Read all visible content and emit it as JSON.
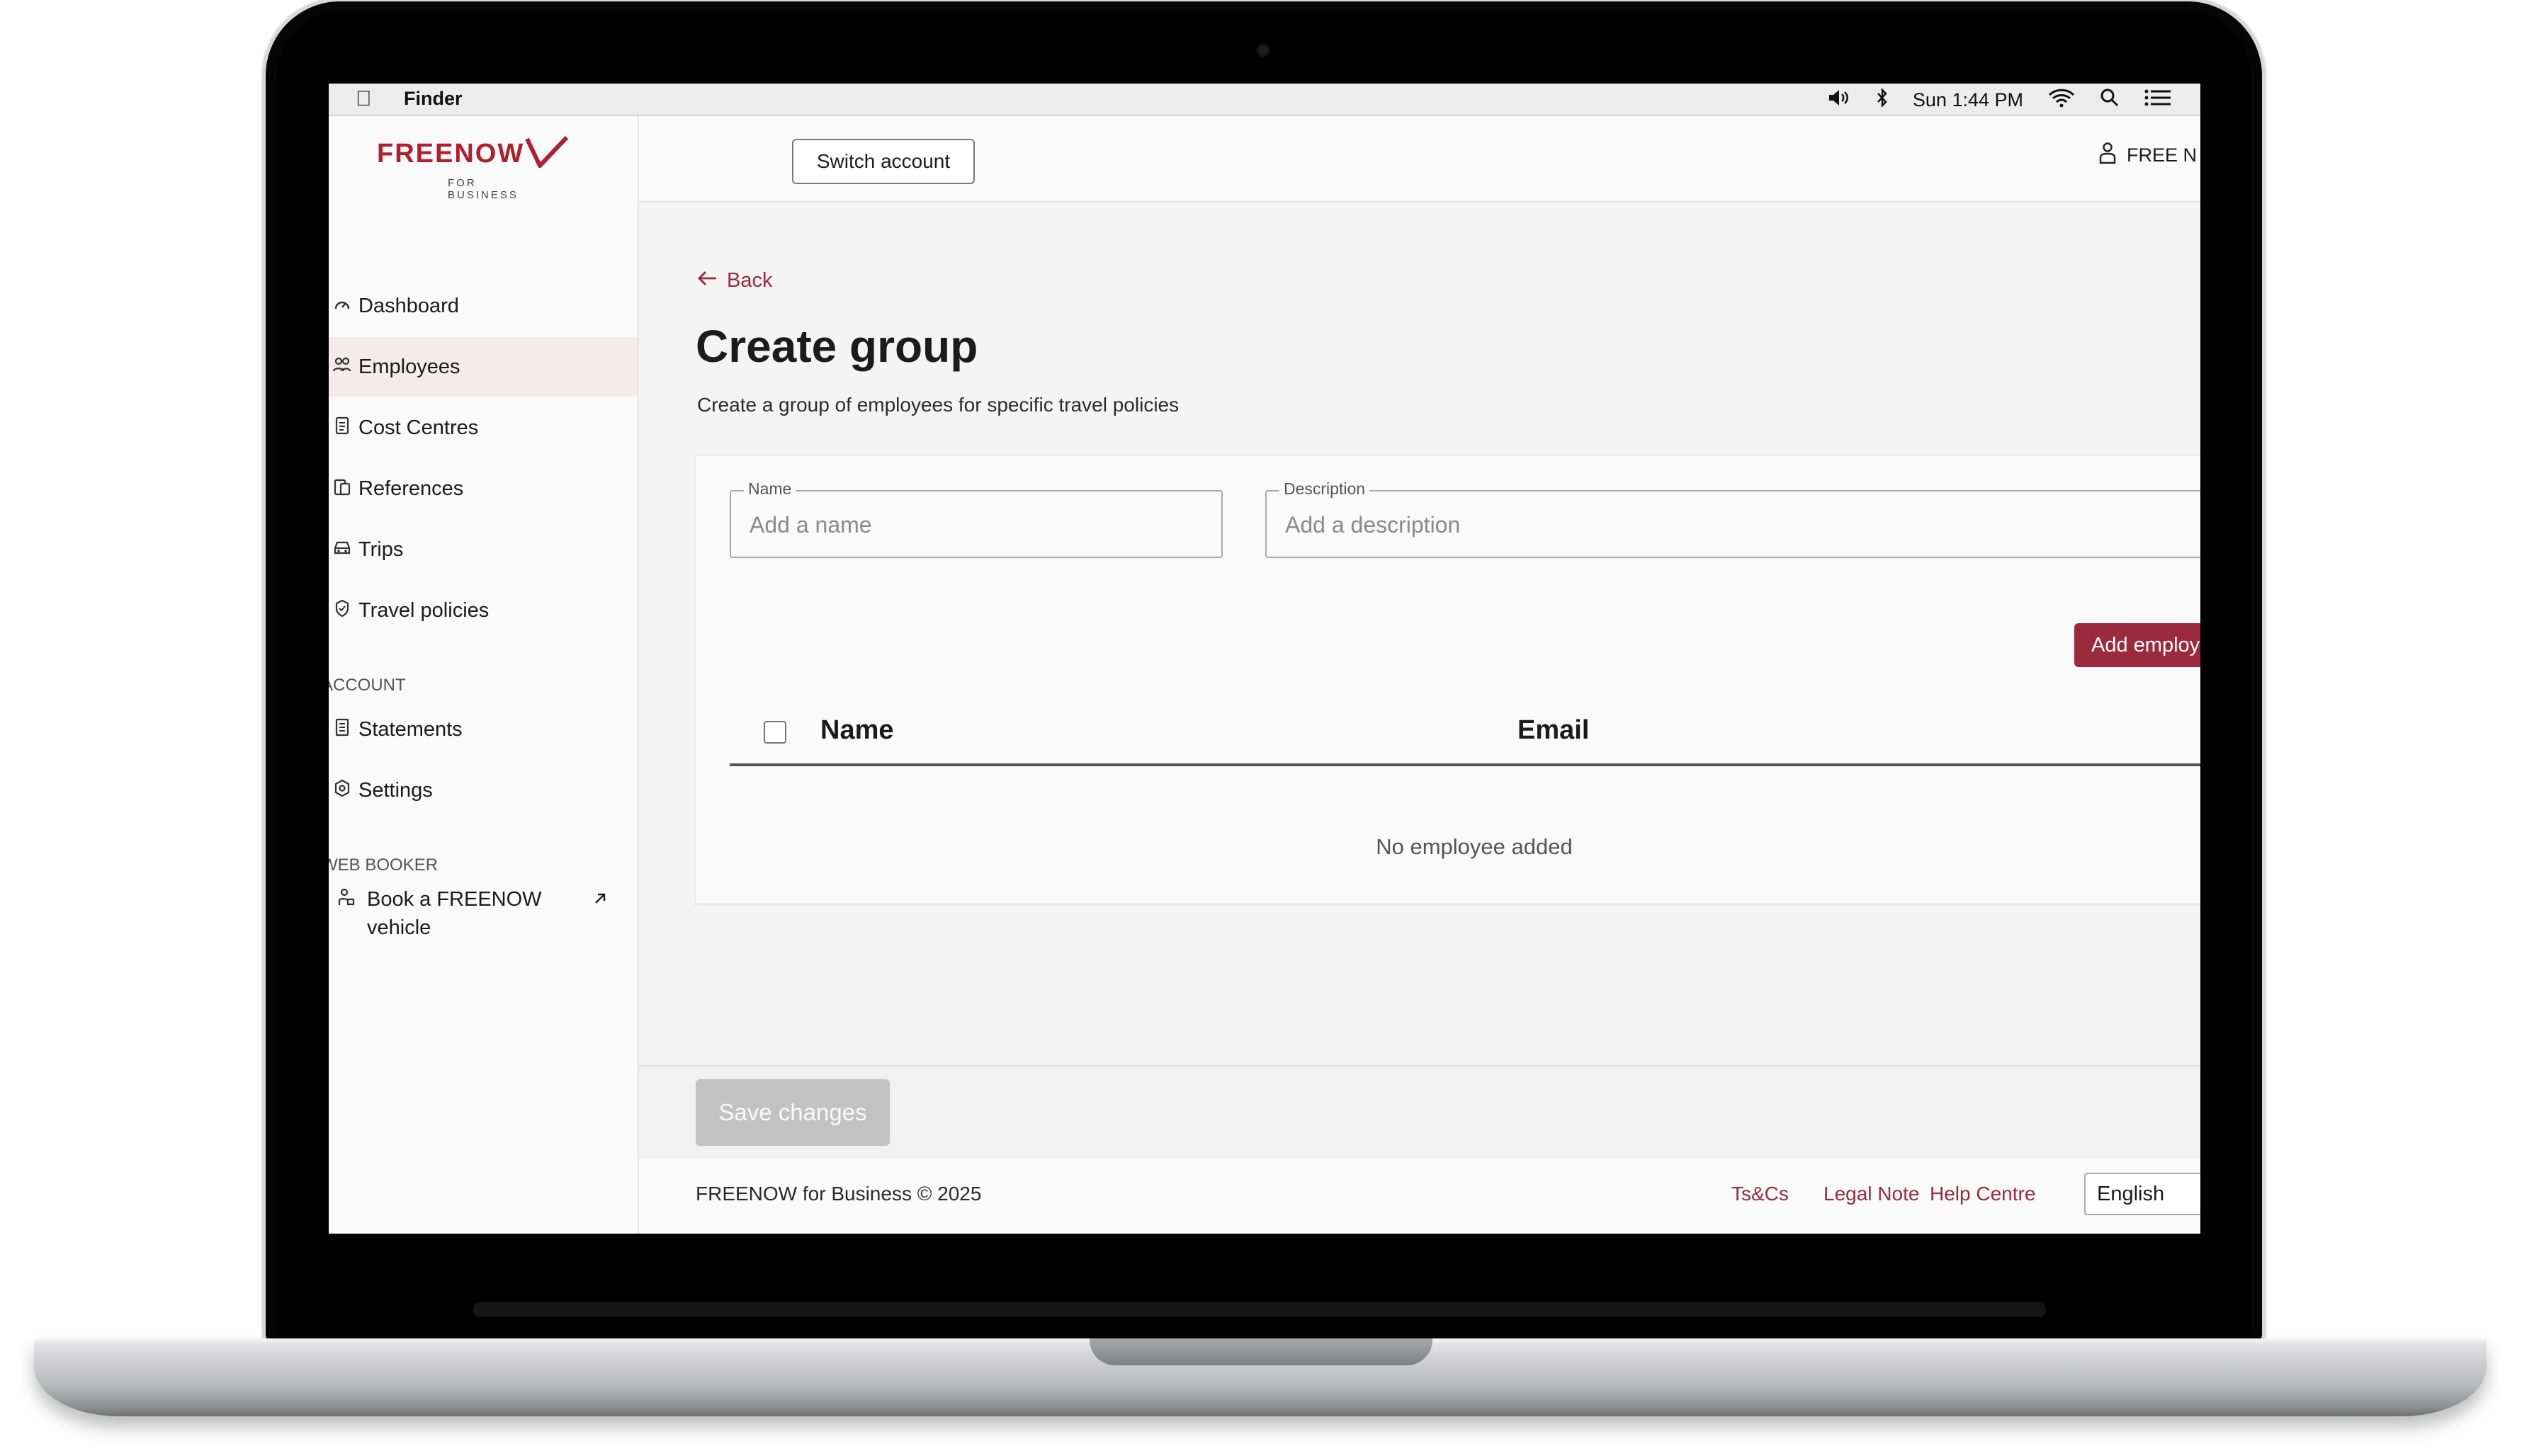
{
  "menubar": {
    "app_name": "Finder",
    "clock": "Sun 1:44 PM"
  },
  "brand": {
    "logo_text": "FREENOW",
    "logo_sub": "FOR BUSINESS",
    "accent_color": "#9b2a3d"
  },
  "sidebar": {
    "items": [
      {
        "label": "Dashboard",
        "icon": "gauge-icon"
      },
      {
        "label": "Employees",
        "icon": "users-icon",
        "active": true
      },
      {
        "label": "Cost Centres",
        "icon": "document-icon"
      },
      {
        "label": "References",
        "icon": "clipboard-icon"
      },
      {
        "label": "Trips",
        "icon": "car-icon"
      },
      {
        "label": "Travel policies",
        "icon": "shield-icon"
      }
    ],
    "section_account": "ACCOUNT",
    "account_items": [
      {
        "label": "Statements",
        "icon": "statement-icon"
      },
      {
        "label": "Settings",
        "icon": "settings-icon"
      }
    ],
    "section_web_booker": "WEB BOOKER",
    "book_label_line1": "Book a FREENOW",
    "book_label_line2": "vehicle"
  },
  "topbar": {
    "switch_account_label": "Switch account",
    "user_name": "FREE N"
  },
  "page": {
    "back_label": "Back",
    "title": "Create group",
    "subtitle": "Create a group of employees for specific travel policies"
  },
  "form": {
    "name_label": "Name",
    "name_placeholder": "Add a name",
    "description_label": "Description",
    "description_placeholder": "Add a description",
    "add_employees_label": "Add employ"
  },
  "table": {
    "columns": [
      "Name",
      "Email"
    ],
    "empty_message": "No employee added"
  },
  "actions": {
    "save_label": "Save changes"
  },
  "footer": {
    "copyright": "FREENOW for Business © 2025",
    "links": [
      "Ts&Cs",
      "Legal Note",
      "Help Centre"
    ],
    "language": "English"
  }
}
